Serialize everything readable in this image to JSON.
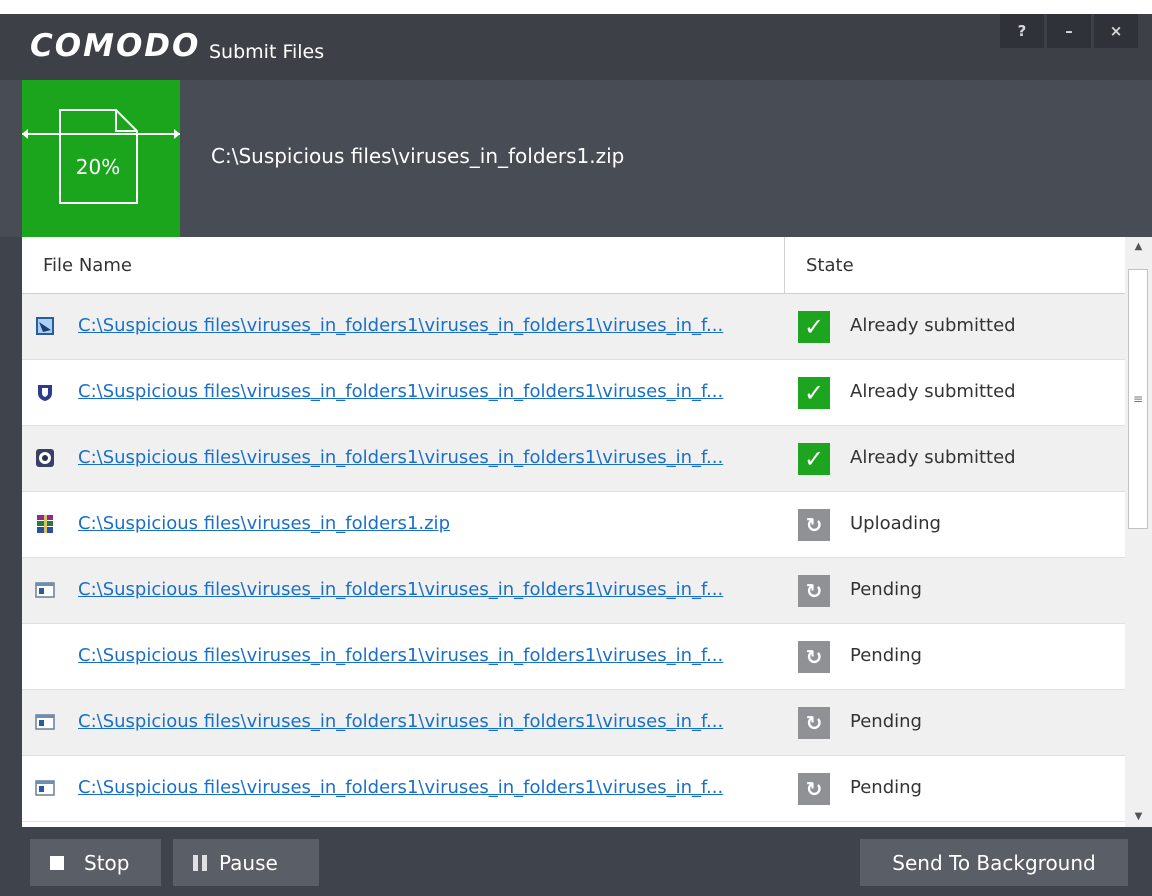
{
  "window": {
    "brand": "COMODO",
    "title": "Submit Files",
    "controls": {
      "help": "?",
      "minimize": "–",
      "close": "×"
    }
  },
  "progress": {
    "percent_label": "20%",
    "percent": 20,
    "current_file": "C:\\Suspicious files\\viruses_in_folders1.zip",
    "accent": "#1aa51d"
  },
  "table": {
    "headers": {
      "name": "File Name",
      "state": "State"
    },
    "rows": [
      {
        "icon": "image-file-icon",
        "name": "C:\\Suspicious files\\viruses_in_folders1\\viruses_in_folders1\\viruses_in_f...",
        "state": "Already submitted",
        "status": "done"
      },
      {
        "icon": "shield-file-icon",
        "name": "C:\\Suspicious files\\viruses_in_folders1\\viruses_in_folders1\\viruses_in_f...",
        "state": "Already submitted",
        "status": "done"
      },
      {
        "icon": "app-file-icon",
        "name": "C:\\Suspicious files\\viruses_in_folders1\\viruses_in_folders1\\viruses_in_f...",
        "state": "Already submitted",
        "status": "done"
      },
      {
        "icon": "archive-file-icon",
        "name": "C:\\Suspicious files\\viruses_in_folders1.zip",
        "state": "Uploading",
        "status": "wait"
      },
      {
        "icon": "window-file-icon",
        "name": "C:\\Suspicious files\\viruses_in_folders1\\viruses_in_folders1\\viruses_in_f...",
        "state": "Pending",
        "status": "wait"
      },
      {
        "icon": "",
        "name": "C:\\Suspicious files\\viruses_in_folders1\\viruses_in_folders1\\viruses_in_f...",
        "state": "Pending",
        "status": "wait"
      },
      {
        "icon": "window-file-icon",
        "name": "C:\\Suspicious files\\viruses_in_folders1\\viruses_in_folders1\\viruses_in_f...",
        "state": "Pending",
        "status": "wait"
      },
      {
        "icon": "window-file-icon",
        "name": "C:\\Suspicious files\\viruses_in_folders1\\viruses_in_folders1\\viruses_in_f...",
        "state": "Pending",
        "status": "wait"
      }
    ]
  },
  "footer": {
    "stop": "Stop",
    "pause": "Pause",
    "background": "Send To Background"
  },
  "colors": {
    "done": "#1ea51f",
    "pending": "#8f9195",
    "link": "#1a6fc9"
  }
}
